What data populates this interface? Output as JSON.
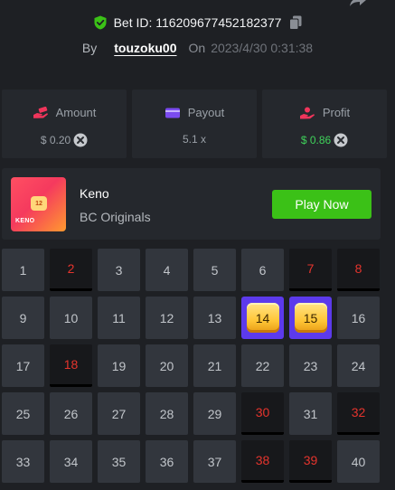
{
  "header": {
    "bet_id_text": "Bet ID: 116209677452182377",
    "by_label": "By",
    "username": "touzoku00",
    "on_label": "On",
    "timestamp": "2023/4/30 0:31:38"
  },
  "stats": {
    "amount": {
      "label": "Amount",
      "value": "$ 0.20"
    },
    "payout": {
      "label": "Payout",
      "value": "5.1 x"
    },
    "profit": {
      "label": "Profit",
      "value": "$ 0.86"
    }
  },
  "game": {
    "thumb_label": "KENO",
    "thumb_number": "12",
    "name": "Keno",
    "provider": "BC Originals",
    "play_label": "Play Now"
  },
  "grid": {
    "cells": [
      {
        "n": "1",
        "state": "normal"
      },
      {
        "n": "2",
        "state": "miss"
      },
      {
        "n": "3",
        "state": "normal"
      },
      {
        "n": "4",
        "state": "normal"
      },
      {
        "n": "5",
        "state": "normal"
      },
      {
        "n": "6",
        "state": "normal"
      },
      {
        "n": "7",
        "state": "miss"
      },
      {
        "n": "8",
        "state": "miss"
      },
      {
        "n": "9",
        "state": "normal"
      },
      {
        "n": "10",
        "state": "normal"
      },
      {
        "n": "11",
        "state": "normal"
      },
      {
        "n": "12",
        "state": "normal"
      },
      {
        "n": "13",
        "state": "normal"
      },
      {
        "n": "14",
        "state": "hit"
      },
      {
        "n": "15",
        "state": "hit"
      },
      {
        "n": "16",
        "state": "normal"
      },
      {
        "n": "17",
        "state": "normal"
      },
      {
        "n": "18",
        "state": "miss"
      },
      {
        "n": "19",
        "state": "normal"
      },
      {
        "n": "20",
        "state": "normal"
      },
      {
        "n": "21",
        "state": "normal"
      },
      {
        "n": "22",
        "state": "normal"
      },
      {
        "n": "23",
        "state": "normal"
      },
      {
        "n": "24",
        "state": "normal"
      },
      {
        "n": "25",
        "state": "normal"
      },
      {
        "n": "26",
        "state": "normal"
      },
      {
        "n": "27",
        "state": "normal"
      },
      {
        "n": "28",
        "state": "normal"
      },
      {
        "n": "29",
        "state": "normal"
      },
      {
        "n": "30",
        "state": "miss"
      },
      {
        "n": "31",
        "state": "normal"
      },
      {
        "n": "32",
        "state": "miss"
      },
      {
        "n": "33",
        "state": "normal"
      },
      {
        "n": "34",
        "state": "normal"
      },
      {
        "n": "35",
        "state": "normal"
      },
      {
        "n": "36",
        "state": "normal"
      },
      {
        "n": "37",
        "state": "normal"
      },
      {
        "n": "38",
        "state": "miss"
      },
      {
        "n": "39",
        "state": "miss"
      },
      {
        "n": "40",
        "state": "normal"
      }
    ]
  },
  "colors": {
    "background": "#1e2024",
    "panel": "#25282d",
    "cell": "#32363d",
    "hit_cell": "#5c3aec",
    "miss_text": "#e5342d",
    "profit_green": "#3fd25a",
    "play_button": "#3bc117"
  },
  "icons": {
    "share": "share-icon",
    "shield": "shield-check-icon",
    "copy": "copy-icon",
    "amount": "money-hand-icon",
    "payout": "wallet-icon",
    "profit": "profit-hand-icon",
    "currency": "coin-icon"
  }
}
